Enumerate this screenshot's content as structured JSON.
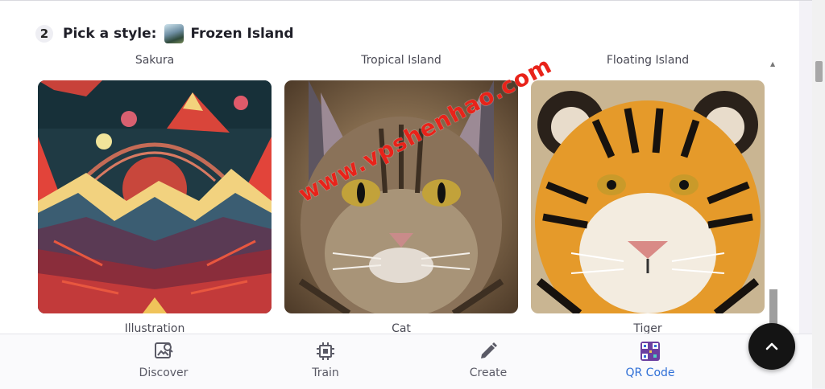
{
  "step": {
    "number": "2",
    "label": "Pick a style:",
    "selected_style": "Frozen Island"
  },
  "top_labels": [
    "Sakura",
    "Tropical Island",
    "Floating Island"
  ],
  "cards": [
    {
      "label": "Illustration",
      "image": "mountain-illustration"
    },
    {
      "label": "Cat",
      "image": "cat-painting"
    },
    {
      "label": "Tiger",
      "image": "tiger-painting"
    }
  ],
  "watermark": "www.vpshenhao.com",
  "nav": {
    "items": [
      {
        "label": "Discover",
        "icon": "discover-icon",
        "active": false
      },
      {
        "label": "Train",
        "icon": "chip-icon",
        "active": false
      },
      {
        "label": "Create",
        "icon": "pencil-icon",
        "active": false
      },
      {
        "label": "QR Code",
        "icon": "qr-code-icon",
        "active": true
      }
    ]
  },
  "colors": {
    "accent": "#2f6fd6",
    "fab": "#141414",
    "watermark": "#e8231a"
  },
  "fab_icon": "chevron-up-icon"
}
